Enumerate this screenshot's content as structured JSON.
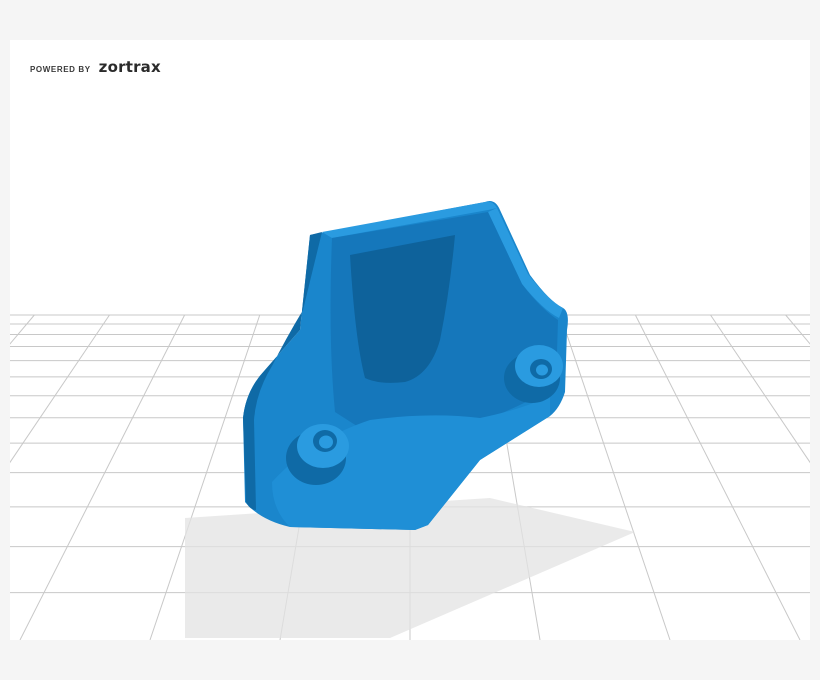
{
  "branding": {
    "powered_by": "POWERED BY",
    "name": "zortrax"
  },
  "scene": {
    "background": "#ffffff",
    "grid_color": "#c8c8c8",
    "shadow_color": "#e3e3e3",
    "model_color": "#1a86cc",
    "model_highlight": "#2a9be0",
    "model_shade": "#0f6aa6"
  }
}
